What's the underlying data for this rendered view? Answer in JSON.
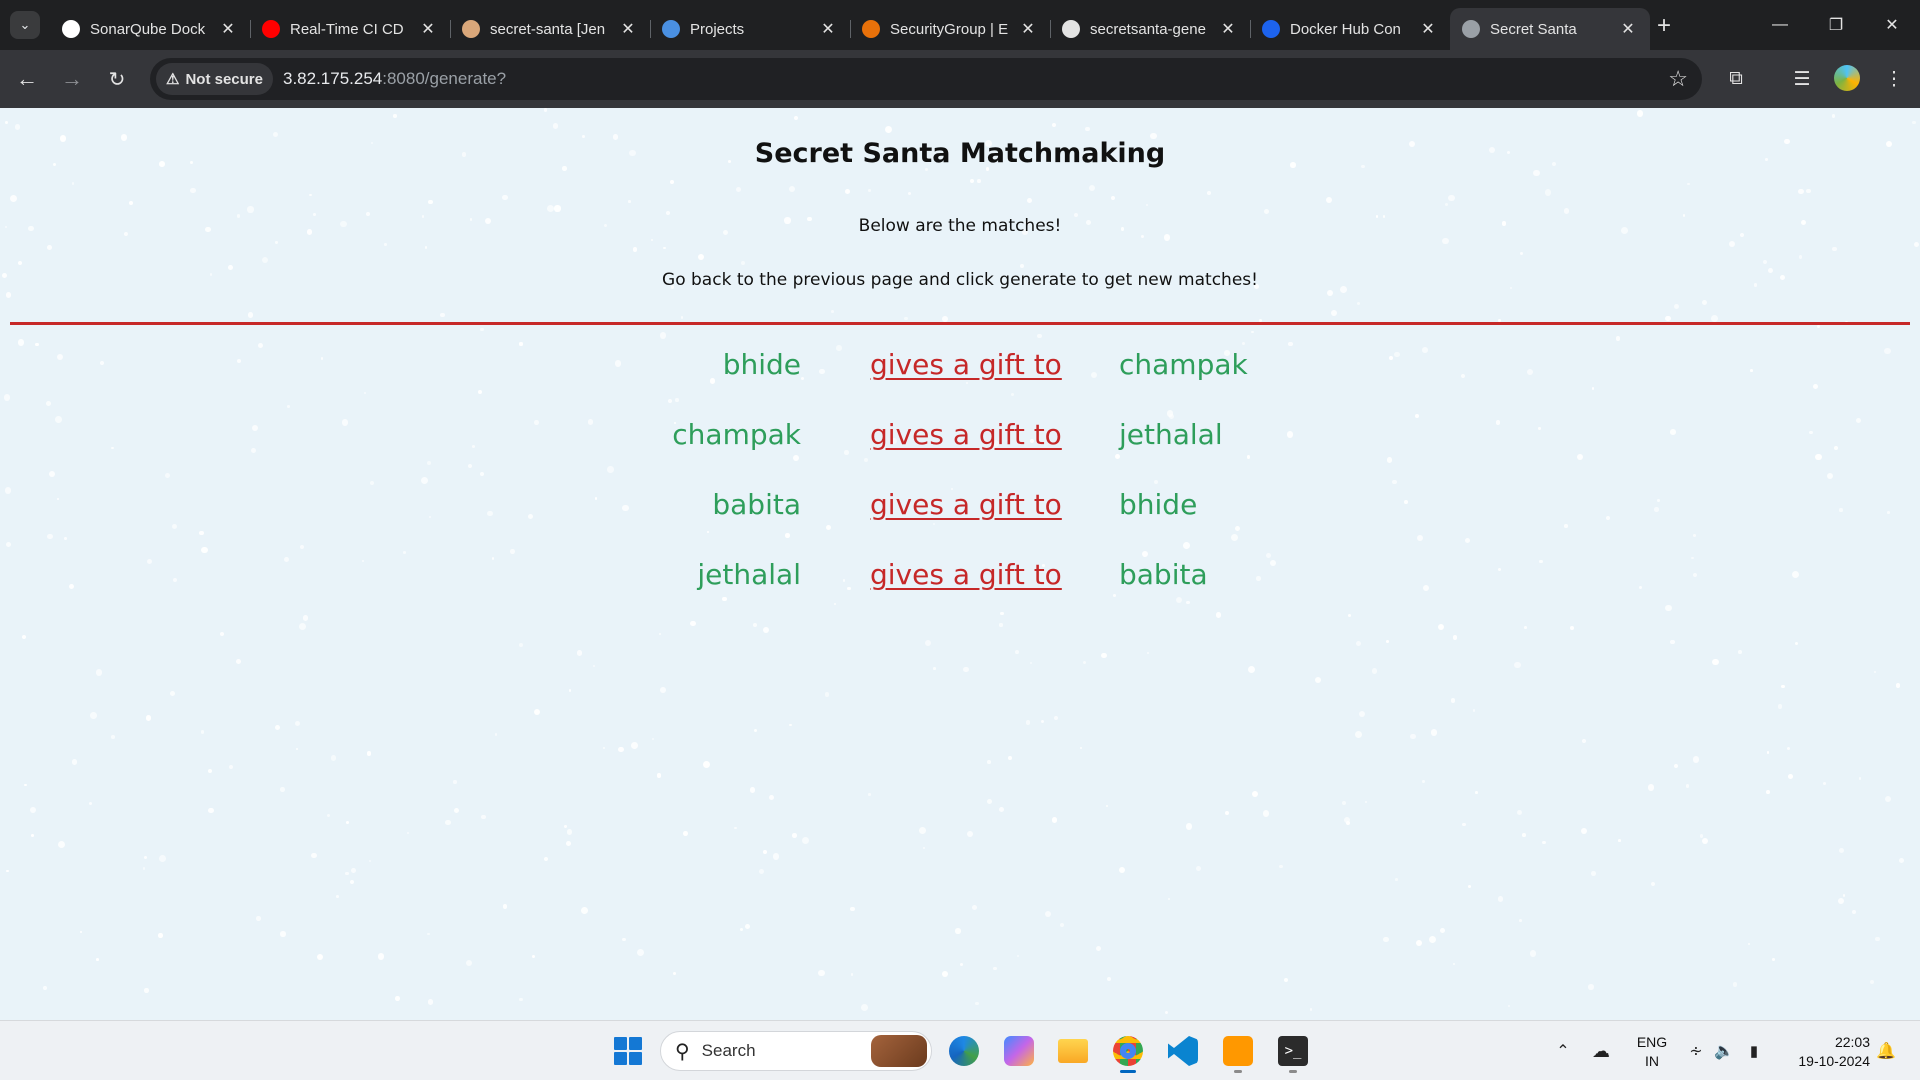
{
  "browser": {
    "tabs": [
      {
        "title": "SonarQube Dock",
        "icon": "sonarqube-icon",
        "color": "#ffffff",
        "active": false
      },
      {
        "title": "Real-Time CI CD",
        "icon": "youtube-icon",
        "color": "#ff0000",
        "active": false
      },
      {
        "title": "secret-santa [Jen",
        "icon": "jenkins-icon",
        "color": "#d9a77a",
        "active": false
      },
      {
        "title": "Projects",
        "icon": "sonarqube-projects-icon",
        "color": "#4a90e2",
        "active": false
      },
      {
        "title": "SecurityGroup | E",
        "icon": "aws-icon",
        "color": "#e8710a",
        "active": false
      },
      {
        "title": "secretsanta-gene",
        "icon": "github-icon",
        "color": "#e3e3e3",
        "active": false
      },
      {
        "title": "Docker Hub Con",
        "icon": "docker-icon",
        "color": "#1d63ed",
        "active": false
      },
      {
        "title": "Secret Santa",
        "icon": "globe-icon",
        "color": "#9aa0a6",
        "active": true
      }
    ],
    "address": {
      "security_label": "Not secure",
      "host": "3.82.175.254",
      "path": ":8080/generate?"
    }
  },
  "page": {
    "title": "Secret Santa Matchmaking",
    "message1": "Below are the matches!",
    "message2": "Go back to the previous page and click generate to get new matches!",
    "divider_color": "#c62828",
    "name_color": "#2e9e5b",
    "link_color": "#c62828",
    "matches": [
      {
        "giver": "bhide",
        "link": "gives a gift to",
        "receiver": "champak"
      },
      {
        "giver": "champak",
        "link": "gives a gift to",
        "receiver": "jethalal"
      },
      {
        "giver": "babita",
        "link": "gives a gift to",
        "receiver": "bhide"
      },
      {
        "giver": "jethalal",
        "link": "gives a gift to",
        "receiver": "babita"
      }
    ]
  },
  "taskbar": {
    "search_placeholder": "Search",
    "language": {
      "line1": "ENG",
      "line2": "IN"
    },
    "time": "22:03",
    "date": "19-10-2024"
  }
}
